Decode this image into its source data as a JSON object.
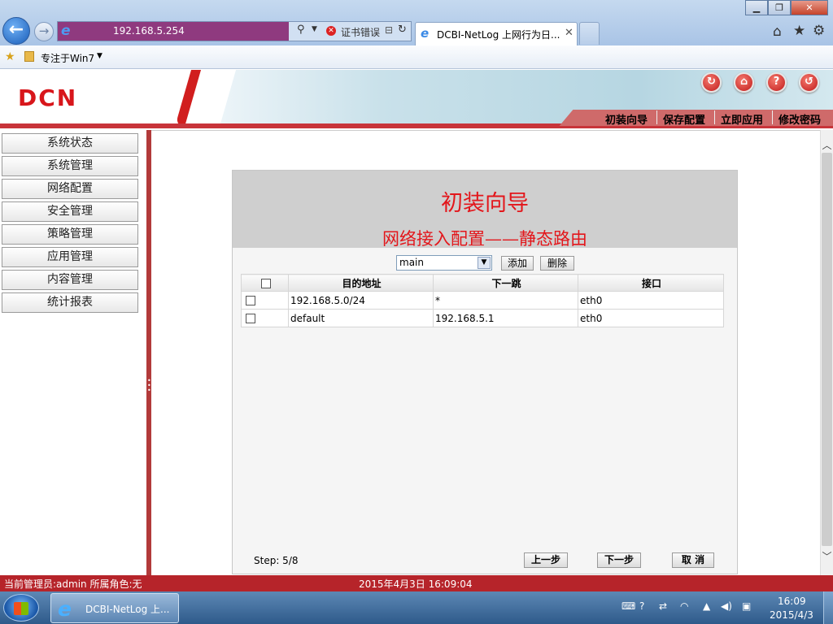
{
  "browser": {
    "url": "192.168.5.254",
    "cert_error": "证书错误",
    "tab_title": "DCBI-NetLog 上网行为日...",
    "favorites_label": "专注于Win7",
    "window_buttons": {
      "minimize": "▁",
      "restore": "❐",
      "close": "✕"
    }
  },
  "app": {
    "logo": "DCN",
    "header_links": [
      "初装向导",
      "保存配置",
      "立即应用",
      "修改密码"
    ],
    "header_icons": [
      "refresh-icon",
      "home-icon",
      "help-icon",
      "logout-icon"
    ]
  },
  "sidebar": {
    "items": [
      "系统状态",
      "系统管理",
      "网络配置",
      "安全管理",
      "策略管理",
      "应用管理",
      "内容管理",
      "统计报表"
    ]
  },
  "wizard": {
    "title": "初装向导",
    "subtitle": "网络接入配置——静态路由",
    "table_select": "main",
    "add_label": "添加",
    "delete_label": "删除",
    "columns": [
      "目的地址",
      "下一跳",
      "接口"
    ],
    "rows": [
      {
        "dest": "192.168.5.0/24",
        "next_hop": "*",
        "iface": "eth0"
      },
      {
        "dest": "default",
        "next_hop": "192.168.5.1",
        "iface": "eth0"
      }
    ],
    "step": "Step: 5/8",
    "prev_label": "上一步",
    "next_label": "下一步",
    "cancel_label": "取 消"
  },
  "status": {
    "user": "当前管理员:admin  所属角色:无",
    "time": "2015年4月3日  16:09:04"
  },
  "taskbar": {
    "task_label": "DCBI-NetLog 上...",
    "clock_time": "16:09",
    "clock_date": "2015/4/3"
  },
  "colors": {
    "brand_red": "#d8161b",
    "status_red": "#b6242a"
  }
}
